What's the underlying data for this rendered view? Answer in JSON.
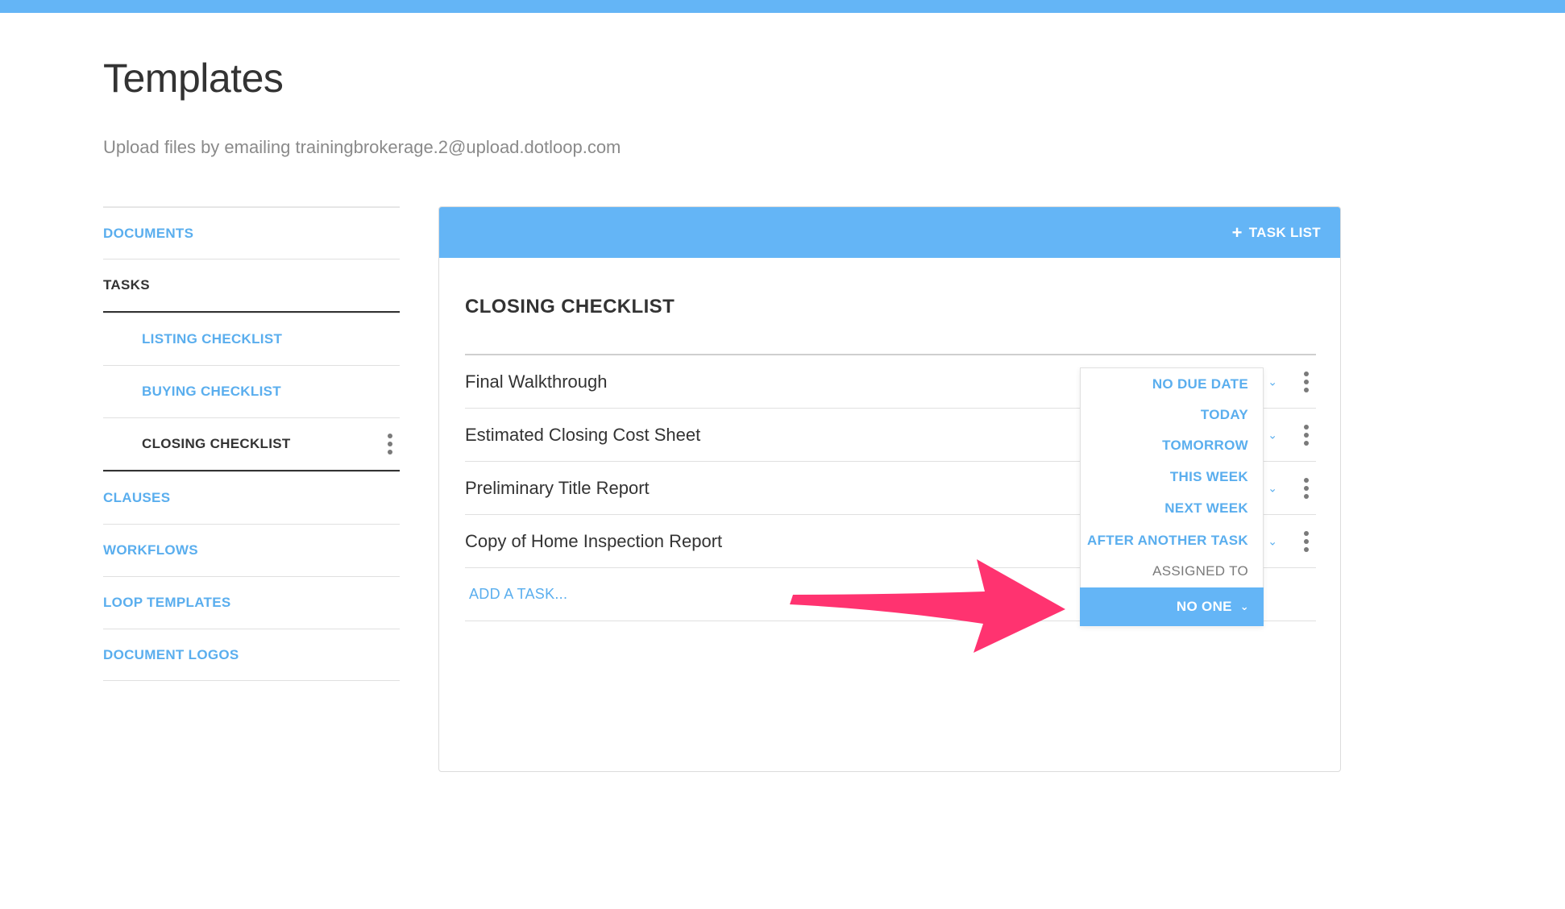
{
  "page": {
    "title": "Templates",
    "subtitle": "Upload files by emailing trainingbrokerage.2@upload.dotloop.com"
  },
  "sidebar": {
    "items": [
      {
        "label": "DOCUMENTS"
      },
      {
        "label": "TASKS"
      },
      {
        "label": "LISTING CHECKLIST"
      },
      {
        "label": "BUYING CHECKLIST"
      },
      {
        "label": "CLOSING CHECKLIST"
      },
      {
        "label": "CLAUSES"
      },
      {
        "label": "WORKFLOWS"
      },
      {
        "label": "LOOP TEMPLATES"
      },
      {
        "label": "DOCUMENT LOGOS"
      }
    ]
  },
  "panel": {
    "add_button_label": "TASK LIST",
    "list_title": "CLOSING CHECKLIST",
    "tasks": [
      {
        "name": "Final Walkthrough"
      },
      {
        "name": "Estimated Closing Cost Sheet"
      },
      {
        "name": "Preliminary Title Report"
      },
      {
        "name": "Copy of Home Inspection Report"
      }
    ],
    "add_task_placeholder": "ADD A TASK..."
  },
  "dropdown": {
    "due_options": [
      "NO DUE DATE",
      "TODAY",
      "TOMORROW",
      "THIS WEEK",
      "NEXT WEEK",
      "AFTER ANOTHER TASK"
    ],
    "assigned_label": "ASSIGNED TO",
    "assigned_value": "NO ONE"
  },
  "colors": {
    "accent": "#64b5f6",
    "link": "#5aaeee",
    "arrow": "#ff3370"
  }
}
